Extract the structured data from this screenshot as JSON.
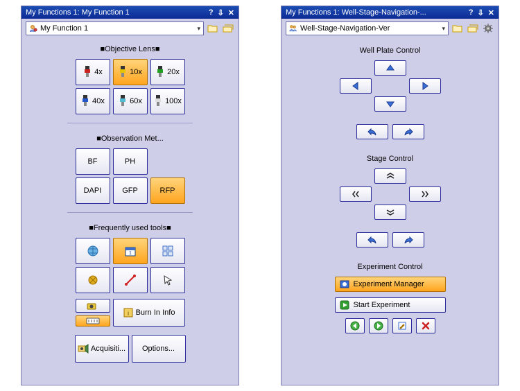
{
  "panels": {
    "left": {
      "title": "My Functions 1: My Function 1",
      "dropdown": "My Function 1",
      "groups": {
        "objective": {
          "title": "■Objective Lens■",
          "items": [
            "4x",
            "10x",
            "20x",
            "40x",
            "60x",
            "100x"
          ]
        },
        "observation": {
          "title": "■Observation Met...",
          "items": [
            "BF",
            "PH",
            "DAPI",
            "GFP",
            "RFP"
          ]
        },
        "tools": {
          "title": "■Frequently used tools■",
          "burn_in": "Burn In Info",
          "acquisition": "Acquisiti...",
          "options": "Options..."
        }
      }
    },
    "right": {
      "title": "My Functions 1: Well-Stage-Navigation-...",
      "dropdown": "Well-Stage-Navigation-Ver",
      "wellplate_title": "Well Plate Control",
      "stage_title": "Stage Control",
      "experiment_title": "Experiment Control",
      "exp_manager": "Experiment Manager",
      "start_experiment": "Start Experiment"
    }
  },
  "titlebar_icons": {
    "help": "?",
    "pin": "📌",
    "close": "✕"
  }
}
